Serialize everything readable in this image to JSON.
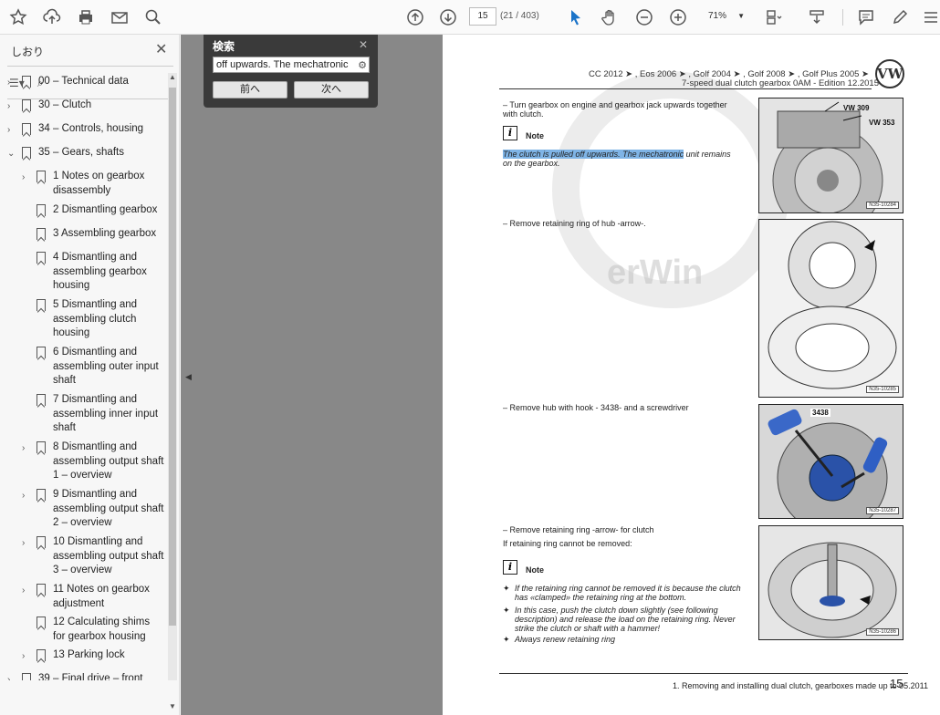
{
  "toolbar": {
    "page_current": "15",
    "page_count": "(21 / 403)",
    "zoom": "71%"
  },
  "sidebar": {
    "title": "しおり",
    "items": [
      {
        "label": "00 – Technical data"
      },
      {
        "label": "30 – Clutch"
      },
      {
        "label": "34 – Controls, housing"
      },
      {
        "label": "35 – Gears, shafts"
      },
      {
        "label": "1 Notes on gearbox disassembly"
      },
      {
        "label": "2 Dismantling gearbox"
      },
      {
        "label": "3 Assembling gearbox"
      },
      {
        "label": "4 Dismantling and assembling gearbox housing"
      },
      {
        "label": "5 Dismantling and assembling clutch housing"
      },
      {
        "label": "6 Dismantling and assembling outer input shaft"
      },
      {
        "label": "7 Dismantling and assembling inner input shaft"
      },
      {
        "label": "8 Dismantling and assembling output shaft 1 – overview"
      },
      {
        "label": "9 Dismantling and assembling output shaft 2 – overview"
      },
      {
        "label": "10 Dismantling and assembling output shaft 3 – overview"
      },
      {
        "label": "11 Notes on gearbox adjustment"
      },
      {
        "label": "12 Calculating shims for gearbox housing"
      },
      {
        "label": "13 Parking lock"
      },
      {
        "label": "39 – Final drive – front"
      }
    ]
  },
  "search": {
    "title": "検索",
    "value": "off upwards. The mechatronic",
    "prev_label": "前へ",
    "next_label": "次へ"
  },
  "document": {
    "header_line1": "CC 2012 ➤ , Eos 2006 ➤ , Golf 2004 ➤ , Golf 2008 ➤ , Golf Plus 2005 ➤",
    "header_line2": "7-speed dual clutch gearbox 0AM - Edition 12.2015",
    "logo_text": "VW",
    "step1": "–  Turn gearbox on engine and gearbox jack upwards together with clutch.",
    "note_label": "Note",
    "note1_highlight": "The clutch is pulled off upwards. The mechatronic",
    "note1_rest": " unit remains on the gearbox.",
    "step2": "–  Remove retaining ring of hub -arrow-.",
    "step3": "–  Remove hub with hook - 3438- and a screwdriver",
    "step4": "–  Remove retaining ring -arrow- for clutch",
    "cond": "If retaining ring cannot be removed:",
    "note2_b1": "If the retaining ring cannot be removed it is because the clutch has «clamped» the retaining ring at the bottom.",
    "note2_b2": "In this case, push the clutch down slightly (see following description) and release the load on the retaining ring. Never strike the clutch or shaft with a hammer!",
    "note2_b3": "Always renew retaining ring",
    "img1_lbl1": "VW 309",
    "img1_lbl2": "VW 353",
    "img1_code": "N35-10284",
    "img2_code": "N35-10285",
    "img3_lbl": "3438",
    "img3_code": "N35-10287",
    "img4_code": "N35-10286",
    "watermark": "erWin",
    "footer": "1. Removing and installing dual clutch, gearboxes made up to 05.2011",
    "page_number": "15"
  }
}
